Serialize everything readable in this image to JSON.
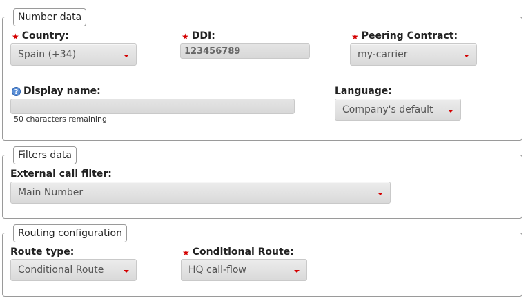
{
  "number_data": {
    "legend": "Number data",
    "country": {
      "label": "Country:",
      "value": "Spain (+34)"
    },
    "ddi": {
      "label": "DDI:",
      "value": "123456789"
    },
    "peering": {
      "label": "Peering Contract:",
      "value": "my-carrier"
    },
    "display_name": {
      "label": "Display name:",
      "value": "",
      "hint": "50 characters remaining"
    },
    "language": {
      "label": "Language:",
      "value": "Company's default"
    }
  },
  "filters_data": {
    "legend": "Filters data",
    "external_call_filter": {
      "label": "External call filter:",
      "value": "Main Number"
    }
  },
  "routing": {
    "legend": "Routing configuration",
    "route_type": {
      "label": "Route type:",
      "value": "Conditional Route"
    },
    "conditional_route": {
      "label": "Conditional Route:",
      "value": "HQ call-flow"
    }
  },
  "colors": {
    "required": "#d40000",
    "border": "#9a9a9a"
  }
}
